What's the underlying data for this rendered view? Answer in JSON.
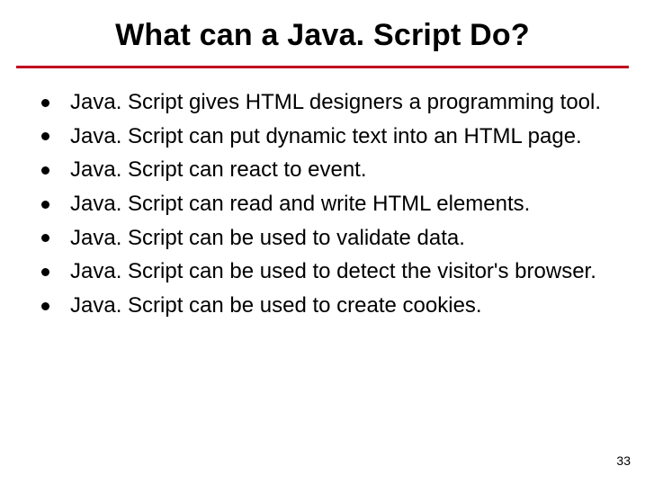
{
  "title": "What can a Java. Script Do?",
  "bullets": [
    "Java. Script gives HTML designers a programming tool.",
    "Java. Script can put dynamic text into an HTML page.",
    "Java. Script can react to event.",
    "Java. Script can read and write HTML elements.",
    "Java. Script can be used to validate data.",
    "Java. Script can be used to detect the visitor's browser.",
    "Java. Script can be used to create cookies."
  ],
  "page_number": "33"
}
